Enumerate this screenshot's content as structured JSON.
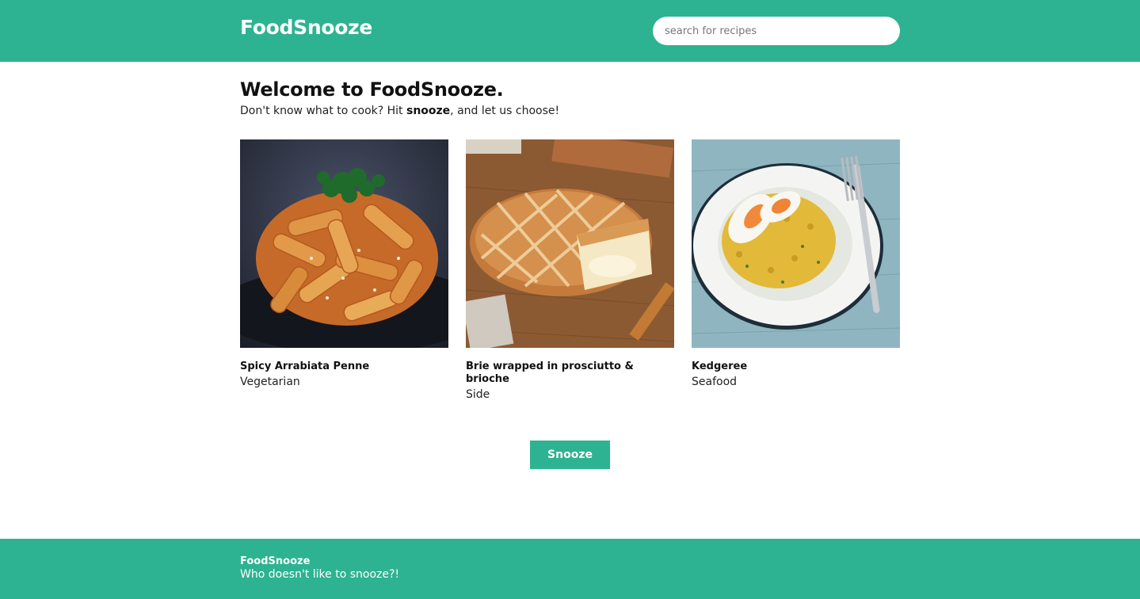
{
  "header": {
    "logo": "FoodSnooze",
    "search_placeholder": "search for recipes"
  },
  "intro": {
    "heading": "Welcome to FoodSnooze.",
    "tagline_before": "Don't know what to cook? Hit ",
    "tagline_bold": "snooze",
    "tagline_after": ", and let us choose!"
  },
  "recipes": [
    {
      "title": "Spicy Arrabiata Penne",
      "category": "Vegetarian",
      "image": "penne-pasta-dish"
    },
    {
      "title": "Brie wrapped in prosciutto & brioche",
      "category": "Side",
      "image": "baked-brie-brioche"
    },
    {
      "title": "Kedgeree",
      "category": "Seafood",
      "image": "kedgeree-rice-plate"
    }
  ],
  "snooze_button": "Snooze",
  "footer": {
    "name": "FoodSnooze",
    "tagline": "Who doesn't like to snooze?!"
  },
  "colors": {
    "brand": "#2db391",
    "text": "#111111",
    "background": "#ffffff"
  }
}
